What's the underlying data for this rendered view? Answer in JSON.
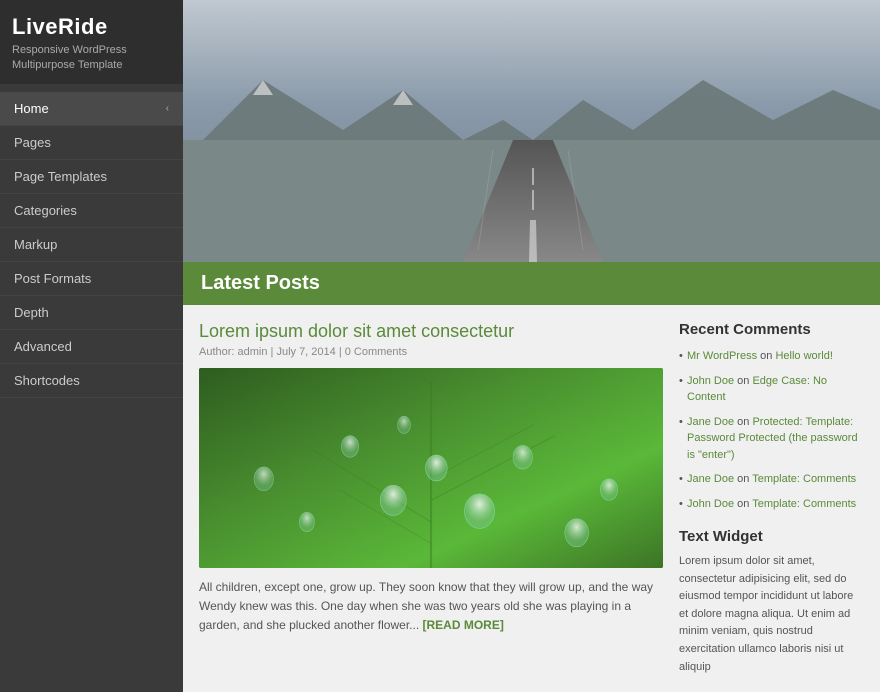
{
  "sidebar": {
    "title": "LiveRide",
    "subtitle": "Responsive WordPress\nMultipurpose Template",
    "nav_items": [
      {
        "label": "Home",
        "has_chevron": true,
        "active": true
      },
      {
        "label": "Pages",
        "has_chevron": false,
        "active": false
      },
      {
        "label": "Page Templates",
        "has_chevron": false,
        "active": false
      },
      {
        "label": "Categories",
        "has_chevron": false,
        "active": false
      },
      {
        "label": "Markup",
        "has_chevron": false,
        "active": false
      },
      {
        "label": "Post Formats",
        "has_chevron": false,
        "active": false
      },
      {
        "label": "Depth",
        "has_chevron": false,
        "active": false
      },
      {
        "label": "Advanced",
        "has_chevron": false,
        "active": false
      },
      {
        "label": "Shortcodes",
        "has_chevron": false,
        "active": false
      }
    ]
  },
  "latest_posts": {
    "section_title": "Latest Posts",
    "post": {
      "title": "Lorem ipsum dolor sit amet consectetur",
      "meta": "Author: admin  |  July 7, 2014  |  0 Comments",
      "excerpt": "All children, except one, grow up. They soon know that they will grow up, and the way Wendy knew was this. One day when she was two years old she was playing in a garden, and she plucked another flower...",
      "read_more": "[READ MORE]"
    }
  },
  "widgets": {
    "recent_comments": {
      "title": "Recent Comments",
      "items": [
        {
          "author": "Mr WordPress",
          "author_link": true,
          "on_text": "on",
          "post": "Hello world!",
          "post_link": true
        },
        {
          "author": "John Doe",
          "author_link": true,
          "on_text": "on",
          "post": "Edge Case: No Content",
          "post_link": true
        },
        {
          "author": "Jane Doe",
          "author_link": true,
          "on_text": "on",
          "post": "Protected: Template: Password Protected (the password is \"enter\")",
          "post_link": true
        },
        {
          "author": "Jane Doe",
          "author_link": true,
          "on_text": "on",
          "post": "Template: Comments",
          "post_link": true
        },
        {
          "author": "John Doe",
          "author_link": true,
          "on_text": "on",
          "post": "Template: Comments",
          "post_link": true
        }
      ]
    },
    "text_widget": {
      "title": "Text Widget",
      "body": "Lorem ipsum dolor sit amet, consectetur adipisicing elit, sed do eiusmod tempor incididunt ut labore et dolore magna aliqua. Ut enim ad minim veniam, quis nostrud exercitation ullamco laboris nisi ut aliquip"
    }
  },
  "colors": {
    "green": "#5a8a3a",
    "sidebar_bg": "#3a3a3a",
    "sidebar_header_bg": "#2e2e2e"
  }
}
